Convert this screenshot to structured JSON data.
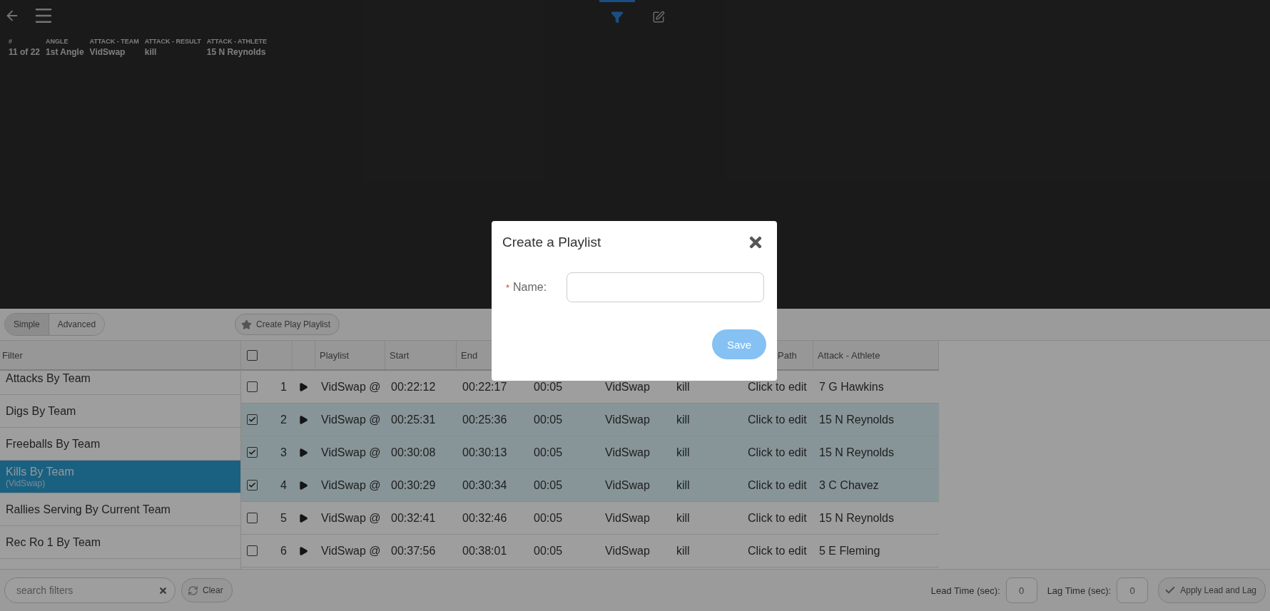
{
  "top_bar": {
    "tabs": [
      {
        "kind": "filter",
        "selected": true
      },
      {
        "kind": "edit",
        "selected": false
      }
    ]
  },
  "clip_info": [
    {
      "label": "#",
      "value": "11 of 22"
    },
    {
      "label": "ANGLE",
      "value": "1st Angle"
    },
    {
      "label": "ATTACK - TEAM",
      "value": "VidSwap"
    },
    {
      "label": "ATTACK - RESULT",
      "value": "kill"
    },
    {
      "label": "ATTACK - ATHLETE",
      "value": "15 N Reynolds"
    }
  ],
  "mode_toggle": [
    {
      "label": "Simple",
      "selected": true
    },
    {
      "label": "Advanced",
      "selected": false
    }
  ],
  "create_play_playlist_button": "Create Play Playlist",
  "filter_panel": {
    "heading": "Filter",
    "items": [
      {
        "label": "Attacks By Team",
        "selected": false
      },
      {
        "label": "Digs By Team",
        "selected": false
      },
      {
        "label": "Freeballs By Team",
        "selected": false
      },
      {
        "label": "Kills By Team",
        "sublabel": "(VidSwap)",
        "selected": true
      },
      {
        "label": "Rallies Serving By Current Team",
        "selected": false
      },
      {
        "label": "Rec Ro 1 By Team",
        "selected": false
      }
    ]
  },
  "table": {
    "select_all_checked": false,
    "columns": [
      {
        "label": "Playlist"
      },
      {
        "label": "Start"
      },
      {
        "label": "End"
      },
      {},
      {},
      {},
      {
        "label": "Path"
      },
      {
        "label": "Attack - Athlete"
      }
    ],
    "rows": [
      {
        "number": "1",
        "selected": false,
        "cells": [
          "VidSwap @",
          "00:22:12",
          "00:22:17",
          "00:05",
          "VidSwap",
          "kill",
          "Click to edit",
          "7 G Hawkins"
        ]
      },
      {
        "number": "2",
        "selected": true,
        "cells": [
          "VidSwap @",
          "00:25:31",
          "00:25:36",
          "00:05",
          "VidSwap",
          "kill",
          "Click to edit",
          "15 N Reynolds"
        ]
      },
      {
        "number": "3",
        "selected": true,
        "cells": [
          "VidSwap @",
          "00:30:08",
          "00:30:13",
          "00:05",
          "VidSwap",
          "kill",
          "Click to edit",
          "15 N Reynolds"
        ]
      },
      {
        "number": "4",
        "selected": true,
        "cells": [
          "VidSwap @",
          "00:30:29",
          "00:30:34",
          "00:05",
          "VidSwap",
          "kill",
          "Click to edit",
          "3 C Chavez"
        ]
      },
      {
        "number": "5",
        "selected": false,
        "cells": [
          "VidSwap @",
          "00:32:41",
          "00:32:46",
          "00:05",
          "VidSwap",
          "kill",
          "Click to edit",
          "15 N Reynolds"
        ]
      },
      {
        "number": "6",
        "selected": false,
        "cells": [
          "VidSwap @",
          "00:37:56",
          "00:38:01",
          "00:05",
          "VidSwap",
          "kill",
          "Click to edit",
          "5 E Fleming"
        ]
      }
    ]
  },
  "bottom_bar": {
    "search": {
      "placeholder": "search filters"
    },
    "clear_button": "Clear",
    "lead_label": "Lead Time (sec):",
    "lead_value": "0",
    "lag_label": "Lag Time (sec):",
    "lag_value": "0",
    "apply_button": "Apply Lead and Lag"
  },
  "modal": {
    "title": "Create a Playlist",
    "required_mark": "*",
    "name_label": "Name:",
    "save_button": "Save"
  }
}
